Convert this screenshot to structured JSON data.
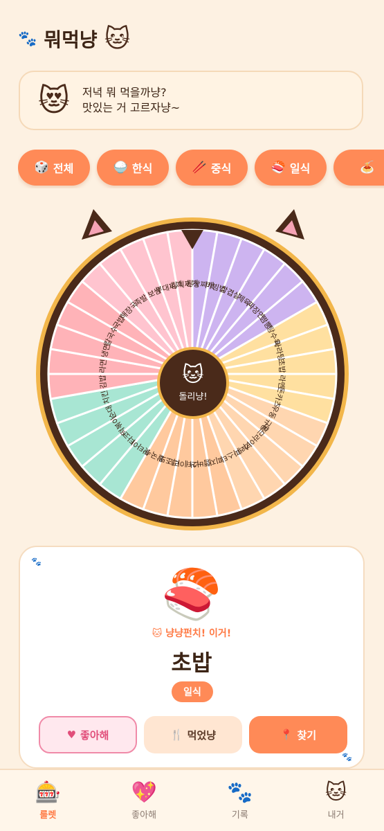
{
  "header": {
    "title": "뭐먹냥",
    "paw_icon": "paw-prints-icon",
    "cat_icon": "cat-face-icon"
  },
  "bubble": {
    "icon": "heart-eyes-cat-icon",
    "line1": "저녁 뭐 먹을까냥?",
    "line2": "맛있는 거 고르자냥~"
  },
  "categories": [
    {
      "emoji": "🎲",
      "label": "전체"
    },
    {
      "emoji": "🍚",
      "label": "한식"
    },
    {
      "emoji": "🥢",
      "label": "중식"
    },
    {
      "emoji": "🍣",
      "label": "일식"
    },
    {
      "emoji": "🍝",
      "label": ""
    }
  ],
  "wheel": {
    "spin_label": "돌리냥!",
    "visible_labels": [
      "된장찌개",
      "비빔밥",
      "삼겹살",
      "제육",
      "짜장면",
      "짬뽕",
      "탕수육",
      "마라탕",
      "초밥",
      "라멘",
      "돈카츠",
      "우동",
      "규동",
      "오므라이스",
      "카레",
      "파스타",
      "피자",
      "햄버거",
      "스테이크",
      "리조또",
      "쌀국수",
      "팟타이",
      "타코",
      "떡볶이",
      "순대",
      "치킨",
      "김밥",
      "라면",
      "냉면",
      "칼국수",
      "국밥",
      "해장국",
      "족발",
      "보쌈",
      "부대찌개",
      "김치찌개"
    ],
    "colors": [
      "#cdb4f0",
      "#ffe0a0",
      "#ffd6b0",
      "#ffc99e",
      "#a8e6d3",
      "#ffb3b8",
      "#ffc4cf"
    ]
  },
  "result": {
    "food_icon": "sushi-icon",
    "pick_text": "냥냥펀치! 이거!",
    "name": "초밥",
    "category": "일식",
    "like_label": "좋아해",
    "ate_label": "먹었냥",
    "find_label": "찾기"
  },
  "tabs": [
    {
      "emoji": "🎰",
      "label": "룰렛",
      "active": true
    },
    {
      "emoji": "💖",
      "label": "좋아해",
      "active": false
    },
    {
      "emoji": "🐾",
      "label": "기록",
      "active": false
    },
    {
      "emoji": "🐱",
      "label": "내거",
      "active": false
    }
  ]
}
